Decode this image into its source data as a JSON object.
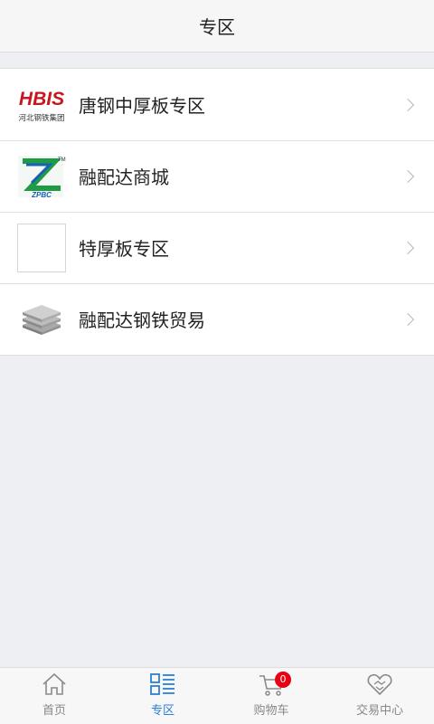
{
  "header": {
    "title": "专区"
  },
  "zones": [
    {
      "label": "唐钢中厚板专区",
      "logo_text": "HBIS",
      "logo_subtext": "河北钢铁集团",
      "icon": "hbis-logo-icon"
    },
    {
      "label": "融配达商城",
      "logo_text": "ZPBC",
      "logo_mark": "TM",
      "icon": "zpbc-logo-icon"
    },
    {
      "label": "特厚板专区",
      "icon": "blank-logo-icon"
    },
    {
      "label": "融配达钢铁贸易",
      "icon": "steel-plates-icon"
    }
  ],
  "tabbar": {
    "home": {
      "label": "首页",
      "icon": "home-icon"
    },
    "zone": {
      "label": "专区",
      "icon": "zone-list-icon"
    },
    "cart": {
      "label": "购物车",
      "icon": "cart-icon",
      "badge": "0"
    },
    "trade": {
      "label": "交易中心",
      "icon": "handshake-icon"
    }
  },
  "colors": {
    "active": "#2a7fd4",
    "inactive": "#888888",
    "badge": "#e60012",
    "hbis_red": "#c8161d"
  }
}
